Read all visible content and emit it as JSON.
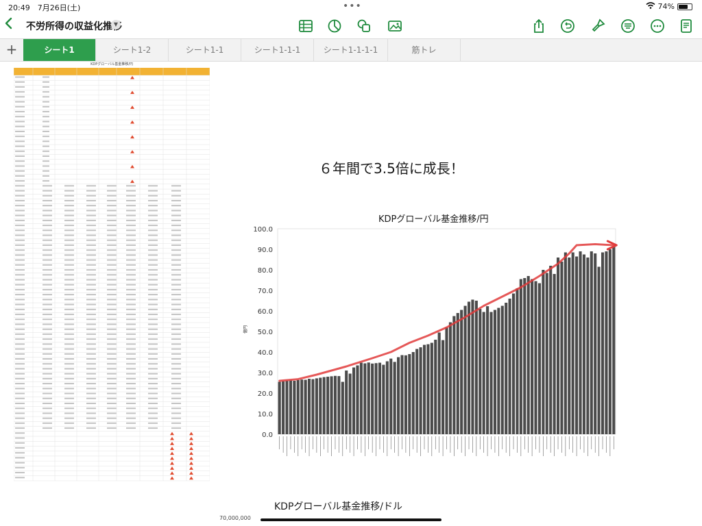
{
  "status": {
    "time": "20:49",
    "date": "7月26日(土)",
    "battery": "74%",
    "battery_level": 0.74
  },
  "toolbar": {
    "title": "不労所得の収益化推移",
    "icons": [
      "table-icon",
      "chart-icon",
      "shapes-icon",
      "media-icon",
      "share-icon",
      "undo-icon",
      "format-brush-icon",
      "format-icon",
      "more-icon",
      "document-icon"
    ]
  },
  "tabs": [
    {
      "label": "シート1",
      "active": true
    },
    {
      "label": "シート1-2",
      "active": false
    },
    {
      "label": "シート1-1",
      "active": false
    },
    {
      "label": "シート1-1-1",
      "active": false
    },
    {
      "label": "シート1-1-1-1",
      "active": false
    },
    {
      "label": "筋トレ",
      "active": false
    }
  ],
  "sheet": {
    "title": "KDPグローバル基金推移/円"
  },
  "headline": "６年間で3.5倍に成長！",
  "chart_data": {
    "type": "bar",
    "title": "KDPグローバル基金推移/円",
    "ylabel": "億円",
    "ylim": [
      0,
      100
    ],
    "yticks": [
      "0.0",
      "10.0",
      "20.0",
      "30.0",
      "40.0",
      "50.0",
      "60.0",
      "70.0",
      "80.0",
      "90.0",
      "100.0"
    ],
    "bar_color": "#4b4b4b",
    "trend_color": "#e03b3b",
    "values": [
      25.5,
      25.8,
      26.1,
      26.2,
      26.0,
      26.4,
      26.6,
      26.5,
      27.0,
      26.8,
      27.2,
      27.5,
      27.8,
      28.0,
      28.2,
      28.4,
      28.3,
      25.5,
      31.0,
      29.5,
      32.5,
      33.5,
      34.8,
      34.5,
      34.9,
      34.4,
      34.6,
      34.8,
      33.8,
      35.5,
      36.8,
      35.2,
      37.5,
      38.5,
      38.4,
      39.0,
      40.0,
      41.5,
      42.3,
      43.5,
      43.8,
      44.5,
      46.0,
      49.5,
      45.8,
      52.0,
      54.5,
      57.5,
      59.0,
      60.5,
      62.5,
      64.5,
      65.5,
      65.0,
      61.0,
      59.5,
      62.3,
      59.5,
      60.5,
      61.5,
      62.5,
      64.0,
      66.0,
      68.5,
      71.0,
      75.5,
      76.0,
      77.0,
      75.5,
      74.5,
      73.5,
      80.0,
      78.5,
      82.0,
      78.0,
      86.0,
      84.0,
      88.5,
      86.0,
      88.5,
      86.5,
      89.0,
      87.5,
      86.0,
      89.0,
      88.0,
      81.5,
      88.5,
      89.0,
      90.0,
      91.5
    ],
    "trend_line": [
      [
        0,
        26.0
      ],
      [
        5,
        26.8
      ],
      [
        10,
        29.0
      ],
      [
        15,
        31.5
      ],
      [
        18,
        33.0
      ],
      [
        25,
        37.0
      ],
      [
        30,
        40.0
      ],
      [
        35,
        44.5
      ],
      [
        40,
        48.0
      ],
      [
        45,
        52.0
      ],
      [
        50,
        57.0
      ],
      [
        55,
        62.5
      ],
      [
        60,
        67.0
      ],
      [
        65,
        71.5
      ],
      [
        70,
        77.0
      ],
      [
        75,
        83.0
      ],
      [
        78,
        88.0
      ],
      [
        80,
        92.0
      ],
      [
        85,
        92.5
      ],
      [
        90,
        92.0
      ]
    ]
  },
  "bottom": {
    "chart_title": "KDPグローバル基金推移/ドル",
    "axis_top": "70,000,000"
  }
}
